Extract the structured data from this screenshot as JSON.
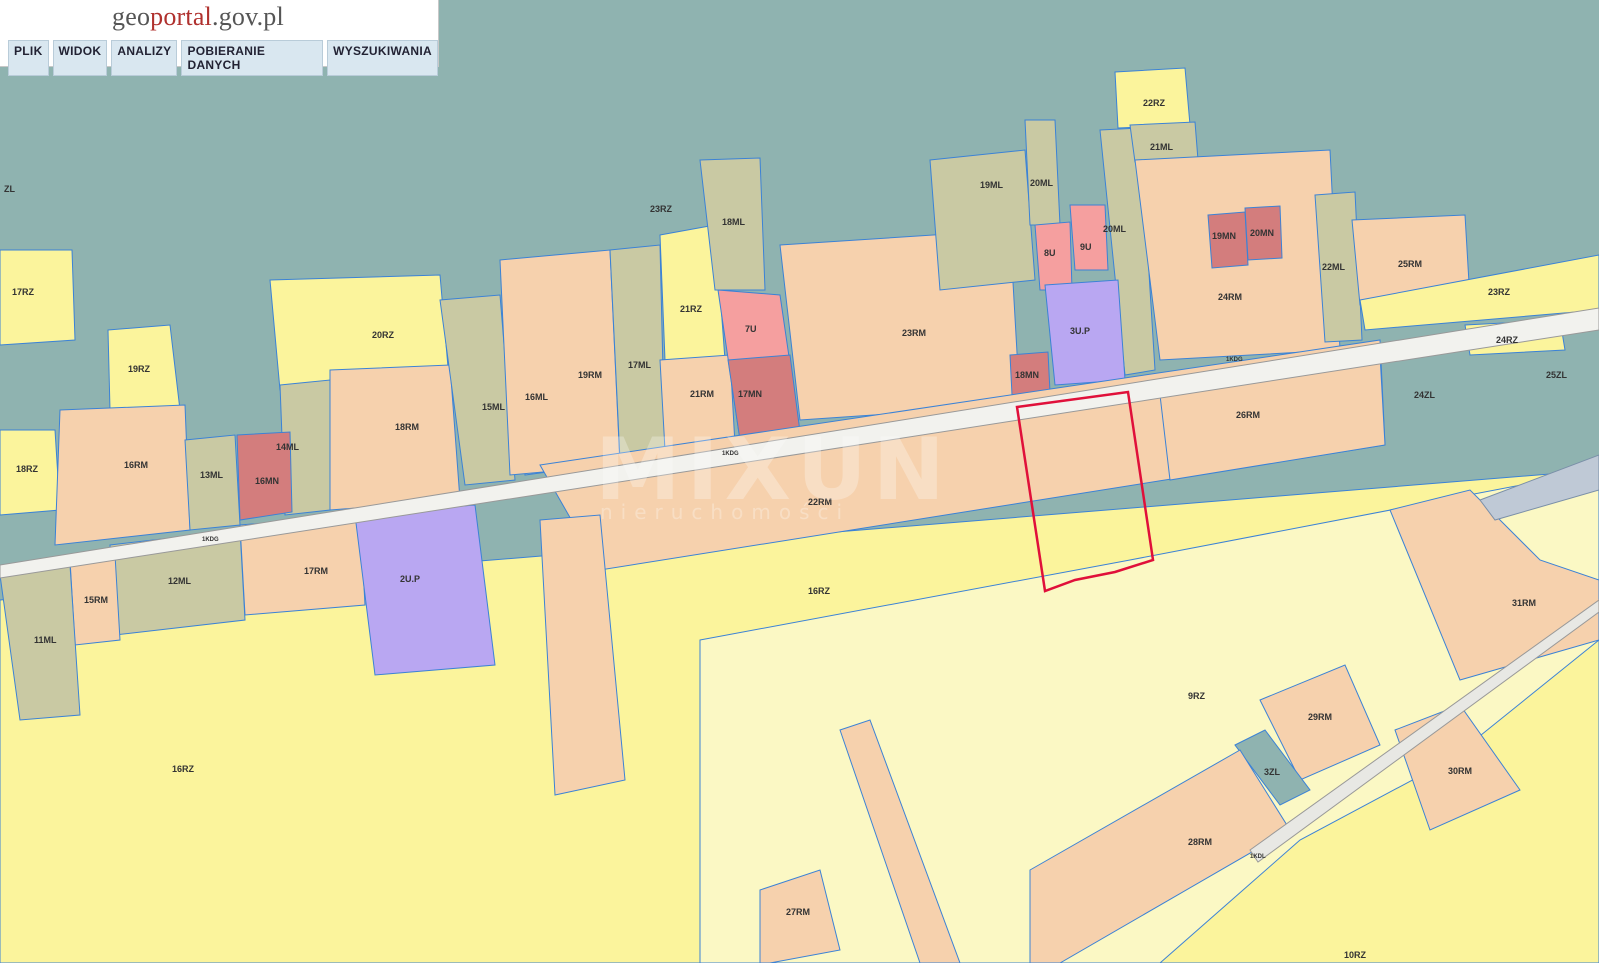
{
  "header": {
    "logo_prefix": "geo",
    "logo_accent": "portal",
    "logo_suffix": ".gov.pl",
    "menu": [
      "PLIK",
      "WIDOK",
      "ANALIZY",
      "POBIERANIE DANYCH",
      "WYSZUKIWANIA"
    ]
  },
  "watermark": {
    "main": "MIXUN",
    "sub": "nieruchomości"
  },
  "colors": {
    "ml": "#c9c9a3",
    "rm": "#f6d1ad",
    "rz": "#fbf49c",
    "u": "#f59f9f",
    "mn": "#d37d7d",
    "up": "#b9a7f2",
    "zl": "#8fb3b0",
    "road": "#f2f2ee",
    "boundary": "#3b82d6",
    "highlight": "#e0103a"
  },
  "map": {
    "labels": [
      "ZL",
      "17RZ",
      "19RZ",
      "18RZ",
      "20RZ",
      "13ML",
      "14ML",
      "16MN",
      "16RM",
      "18RM",
      "15ML",
      "16ML",
      "19RM",
      "17ML",
      "23RZ",
      "18ML",
      "21RZ",
      "7U",
      "17MN",
      "21RM",
      "19ML",
      "20ML",
      "20ML",
      "8U",
      "9U",
      "3U.P",
      "23RM",
      "18MN",
      "22RZ",
      "21ML",
      "19MN",
      "20MN",
      "24RM",
      "22ML",
      "25RM",
      "23RZ",
      "24RZ",
      "25ZL",
      "24ZL",
      "26RM",
      "1KDG",
      "1KDG",
      "1KDG",
      "22RM",
      "12ML",
      "15RM",
      "17RM",
      "2U.P",
      "11ML",
      "16RZ",
      "16RZ",
      "9RZ",
      "31RM",
      "29RM",
      "3ZL",
      "30RM",
      "28RM",
      "27RM",
      "10RZ",
      "1KDL"
    ]
  }
}
